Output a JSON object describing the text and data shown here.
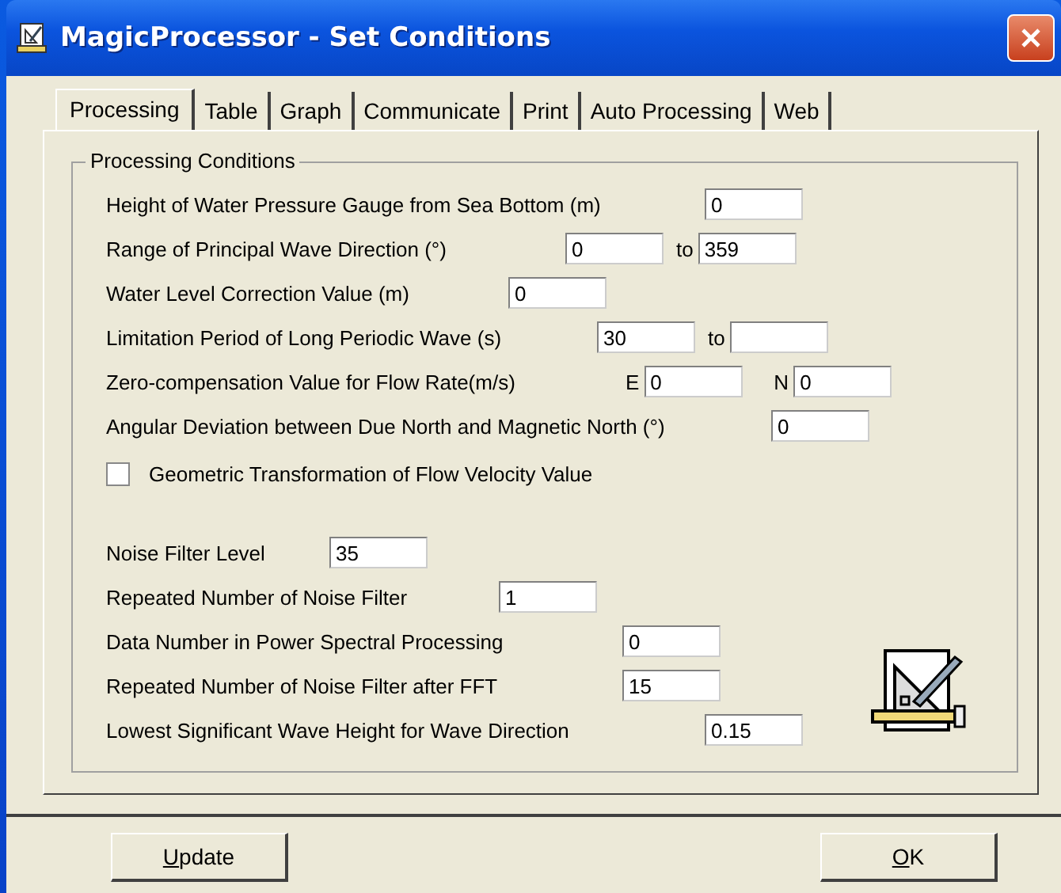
{
  "window": {
    "title": "MagicProcessor - Set Conditions"
  },
  "tabs": [
    {
      "label": "Processing",
      "selected": true
    },
    {
      "label": "Table",
      "selected": false
    },
    {
      "label": "Graph",
      "selected": false
    },
    {
      "label": "Communicate",
      "selected": false
    },
    {
      "label": "Print",
      "selected": false
    },
    {
      "label": "Auto Processing",
      "selected": false
    },
    {
      "label": "Web",
      "selected": false
    }
  ],
  "group": {
    "title": "Processing Conditions"
  },
  "conditions": [
    {
      "label": "Height of Water Pressure Gauge from Sea Bottom (m)",
      "inputs": [
        {
          "value": "0"
        }
      ]
    },
    {
      "label": "Range of Principal Wave Direction (°)",
      "inputs": [
        {
          "value": "0"
        },
        {
          "prefix": "to",
          "value": "359"
        }
      ]
    },
    {
      "label": "Water Level Correction Value (m)",
      "inputs": [
        {
          "value": "0"
        }
      ]
    },
    {
      "label": "Limitation Period of Long Periodic Wave (s)",
      "inputs": [
        {
          "value": "30"
        },
        {
          "prefix": "to"
        }
      ]
    },
    {
      "label": "Zero-compensation Value for Flow Rate(m/s)",
      "inputs": [
        {
          "prefix": "E",
          "value": "0"
        },
        {
          "prefix": "N",
          "value": "0"
        }
      ]
    },
    {
      "label": "Angular Deviation between Due North and Magnetic North (°)",
      "inputs": [
        {
          "value": "0"
        }
      ]
    }
  ],
  "checkbox": {
    "label": "Geometric Transformation of Flow Velocity Value",
    "checked": false
  },
  "filters": [
    {
      "label": "Noise Filter Level",
      "inputs": [
        {
          "value": "35"
        }
      ]
    },
    {
      "label": "Repeated Number of Noise Filter",
      "inputs": [
        {
          "value": "1"
        }
      ]
    },
    {
      "label": "Data Number in Power Spectral Processing",
      "inputs": [
        {
          "value": "0"
        }
      ]
    },
    {
      "label": "Repeated Number of Noise Filter after FFT",
      "inputs": [
        {
          "value": "15"
        }
      ]
    },
    {
      "label": "Lowest Significant Wave Height for Wave Direction",
      "inputs": [
        {
          "value": "0.15"
        }
      ]
    }
  ],
  "buttons": [
    {
      "access_key": "U",
      "label_rest": "pdate"
    },
    {
      "access_key": "O",
      "label_rest": "K"
    }
  ]
}
